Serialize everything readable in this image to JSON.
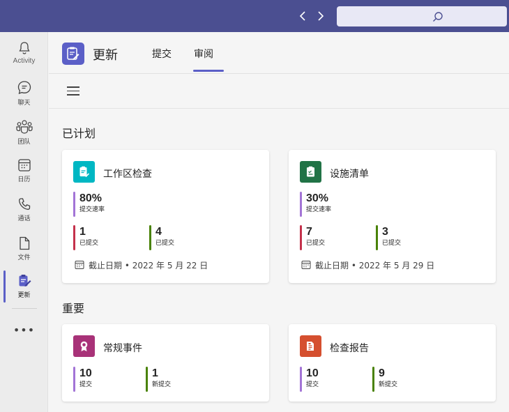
{
  "colors": {
    "topbar": "#4b4f91",
    "brand": "#5b5fc7",
    "purple": "#a374d6",
    "red": "#c4314b",
    "green": "#498205",
    "teal": "#00b7c3",
    "dark_green": "#217346",
    "magenta": "#a83278",
    "orange_red": "#d54f2f"
  },
  "topbar": {
    "back_icon": "chevron-left-icon",
    "forward_icon": "chevron-right-icon",
    "search_icon": "search-icon"
  },
  "rail": {
    "items": [
      {
        "label": "Activity",
        "icon": "bell-icon"
      },
      {
        "label": "聊天",
        "icon": "chat-icon"
      },
      {
        "label": "团队",
        "icon": "teams-icon"
      },
      {
        "label": "日历",
        "icon": "calendar-icon"
      },
      {
        "label": "通话",
        "icon": "phone-icon"
      },
      {
        "label": "文件",
        "icon": "file-icon"
      },
      {
        "label": "更新",
        "icon": "updates-icon"
      }
    ],
    "more": "•••"
  },
  "header": {
    "title": "更新",
    "tabs": [
      {
        "label": "提交"
      },
      {
        "label": "审阅"
      }
    ],
    "active_tab": "审阅"
  },
  "sections": [
    {
      "title": "已计划",
      "cards": [
        {
          "title": "工作区检查",
          "icon": "clipboard-check-icon",
          "rate": {
            "value": "80%",
            "label": "提交速率"
          },
          "stats": [
            {
              "value": "1",
              "label": "已提交"
            },
            {
              "value": "4",
              "label": "已提交"
            }
          ],
          "due": "截止日期 • 2022 年 5 月 22 日"
        },
        {
          "title": "设施清单",
          "icon": "clipboard-task-icon",
          "rate": {
            "value": "30%",
            "label": "提交速率"
          },
          "stats": [
            {
              "value": "7",
              "label": "已提交"
            },
            {
              "value": "3",
              "label": "已提交"
            }
          ],
          "due": "截止日期 • 2022 年 5 月 29 日"
        }
      ]
    },
    {
      "title": "重要",
      "cards": [
        {
          "title": "常规事件",
          "icon": "ribbon-icon",
          "stats": [
            {
              "value": "10",
              "label": "提交"
            },
            {
              "value": "1",
              "label": "新提交"
            }
          ]
        },
        {
          "title": "检查报告",
          "icon": "report-icon",
          "stats": [
            {
              "value": "10",
              "label": "提交"
            },
            {
              "value": "9",
              "label": "新提交"
            }
          ]
        }
      ]
    }
  ]
}
